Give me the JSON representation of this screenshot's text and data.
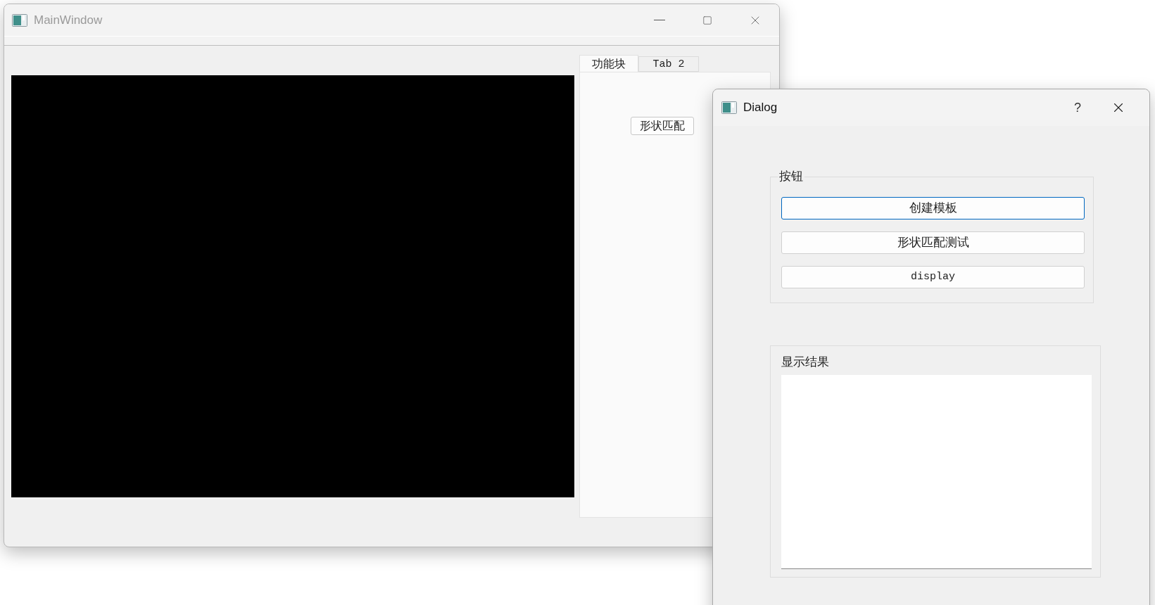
{
  "main_window": {
    "title": "MainWindow",
    "tabs": [
      {
        "label": "功能块",
        "selected": true
      },
      {
        "label": "Tab 2",
        "selected": false
      }
    ],
    "tab_button": "形状匹配"
  },
  "dialog": {
    "title": "Dialog",
    "help": "?",
    "button_group": {
      "title": "按钮",
      "buttons": [
        {
          "label": "创建模板",
          "focused": true
        },
        {
          "label": "形状匹配测试",
          "focused": false
        },
        {
          "label": "display",
          "focused": false
        }
      ]
    },
    "result_group": {
      "title": "显示结果"
    }
  }
}
